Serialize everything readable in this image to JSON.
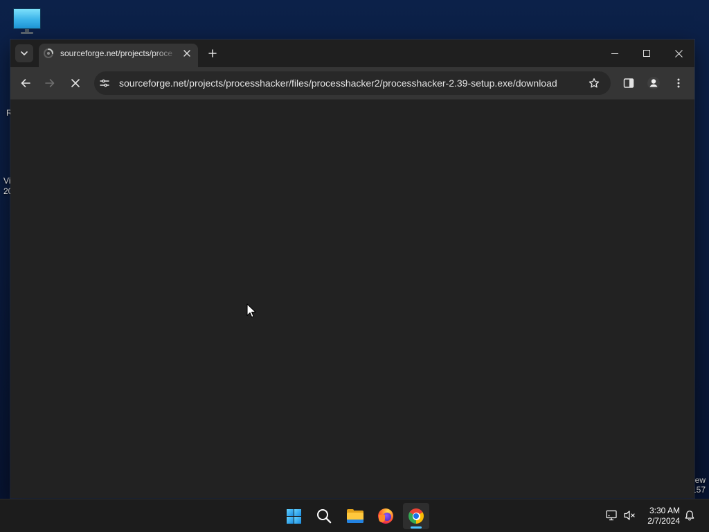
{
  "colors": {
    "desktop_top": "#0c2149",
    "desktop_bottom": "#071330",
    "tab_strip": "#1f1f1f",
    "toolbar": "#353535",
    "omnibox": "#282828",
    "page": "#222222",
    "taskbar": "#1c1c1c",
    "taskbar_accent": "#4cc2ff",
    "text": "#e3e3e3"
  },
  "desktop": {
    "icons": [
      "this-pc-icon"
    ],
    "left_edge_fragments": [
      "R",
      "Vi",
      "20"
    ],
    "right_edge_fragments": [
      "ew",
      "157"
    ]
  },
  "browser": {
    "tab_search_icon": "chevron-down-icon",
    "tabs": [
      {
        "title": "sourceforge.net/projects/proce",
        "favicon": "loading-throbber-icon",
        "close_icon": "close-icon",
        "active": true
      }
    ],
    "new_tab_icon": "plus-icon",
    "window_controls": [
      "minimize-icon",
      "maximize-icon",
      "close-icon"
    ],
    "toolbar": {
      "back_icon": "arrow-left-icon",
      "forward_icon": "arrow-right-icon",
      "forward_enabled": false,
      "stop_icon": "stop-loading-icon",
      "site_info_icon": "tune-icon",
      "url": "sourceforge.net/projects/processhacker/files/processhacker2/processhacker-2.39-setup.exe/download",
      "bookmark_icon": "star-outline-icon",
      "right_icons": [
        "side-panel-icon",
        "profile-icon",
        "kebab-menu-icon"
      ]
    }
  },
  "taskbar": {
    "apps": [
      {
        "icon": "windows-logo-icon",
        "active": false
      },
      {
        "icon": "search-icon",
        "active": false
      },
      {
        "icon": "file-explorer-icon",
        "active": false
      },
      {
        "icon": "firefox-icon",
        "active": false
      },
      {
        "icon": "chrome-icon",
        "active": true
      }
    ],
    "tray_icons": [
      "network-monitor-icon",
      "volume-muted-icon"
    ],
    "clock": {
      "time": "3:30 AM",
      "date": "2/7/2024"
    },
    "notification_icon": "bell-icon"
  }
}
